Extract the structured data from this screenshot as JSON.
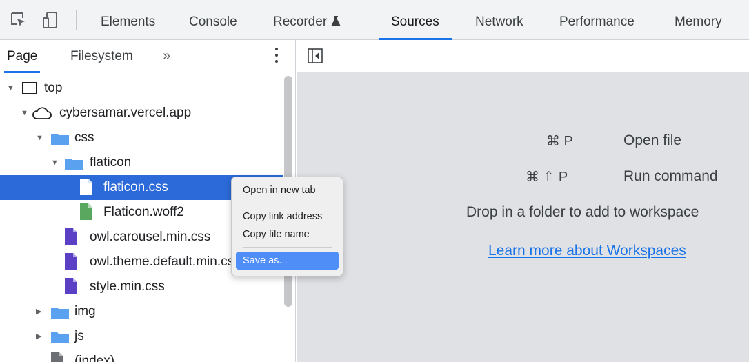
{
  "toolbar": {
    "tabs": [
      "Elements",
      "Console",
      "Recorder",
      "Sources",
      "Network",
      "Performance",
      "Memory"
    ],
    "active_tab": "Sources"
  },
  "left_panel": {
    "tabs": [
      "Page",
      "Filesystem"
    ],
    "more": "»",
    "tree": [
      "top",
      "cybersamar.vercel.app",
      "css",
      "flaticon",
      "flaticon.css",
      "Flaticon.woff2",
      "owl.carousel.min.css",
      "owl.theme.default.min.css",
      "style.min.css",
      "img",
      "js",
      "(index)"
    ]
  },
  "context_menu": {
    "items": [
      "Open in new tab",
      "Copy link address",
      "Copy file name",
      "Save as..."
    ]
  },
  "right_panel": {
    "shortcuts": [
      {
        "keys": "⌘ P",
        "label": "Open file"
      },
      {
        "keys": "⌘ ⇧ P",
        "label": "Run command"
      }
    ],
    "drop_message": "Drop in a folder to add to workspace",
    "learn_link": "Learn more about Workspaces"
  },
  "colors": {
    "accent": "#1a73e8",
    "selection": "#2b6ad8",
    "folder": "#5aa2ef",
    "css_file": "#5b3fc4",
    "font_file": "#5aa860"
  }
}
